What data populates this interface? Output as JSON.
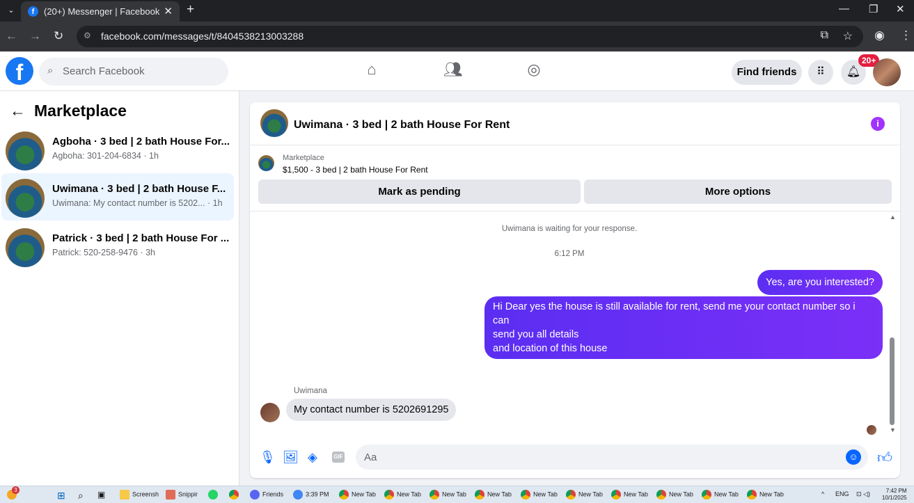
{
  "browser": {
    "tab_title": "(20+) Messenger | Facebook",
    "tab_close": "✕",
    "new_tab": "+",
    "url": "facebook.com/messages/t/8404538213003288"
  },
  "header": {
    "search_placeholder": "Search Facebook",
    "find_friends": "Find friends",
    "notification_badge": "20+"
  },
  "sidebar": {
    "title": "Marketplace",
    "conversations": [
      {
        "name": "Agboha · 3 bed | 2 bath House For...",
        "preview": "Agboha: 301-204-6834 · 1h"
      },
      {
        "name": "Uwimana · 3 bed | 2 bath House F...",
        "preview": "Uwimana: My contact number is 5202... · 1h"
      },
      {
        "name": "Patrick · 3 bed | 2 bath House For ...",
        "preview": "Patrick: 520-258-9476 · 3h"
      }
    ]
  },
  "chat": {
    "title": "Uwimana · 3 bed | 2 bath House For Rent",
    "listing_source": "Marketplace",
    "listing_detail": "$1,500 - 3 bed | 2 bath House For Rent",
    "mark_pending": "Mark as pending",
    "more_options": "More options",
    "system_note": "Uwimana is waiting for your response.",
    "timestamp": "6:12 PM",
    "msg_out_1": "Yes, are you interested?",
    "msg_out_2_line1": "Hi Dear yes the house is still available for rent, send me your contact number so i can",
    "msg_out_2_line2": "send you all details",
    "msg_out_2_line3": "and location of this house",
    "sender_name": "Uwimana",
    "msg_in_1": "My contact number is 5202691295",
    "composer_placeholder": "Aa",
    "gif_label": "GIF"
  },
  "taskbar": {
    "items": [
      "Screensh",
      "Snippir",
      "Friends",
      "3:39 PM",
      "New Tab",
      "New Tab",
      "New Tab",
      "New Tab",
      "New Tab",
      "New Tab",
      "New Tab",
      "New Tab",
      "New Tab",
      "New Tab",
      "New Tab"
    ],
    "lang": "ENG",
    "time": "7:42 PM",
    "date": "10/1/2025",
    "notify_count": "3"
  },
  "colors": {
    "accent": "#0866ff",
    "outgoing_bubble": "#6325f0",
    "badge": "#e41e3f"
  }
}
